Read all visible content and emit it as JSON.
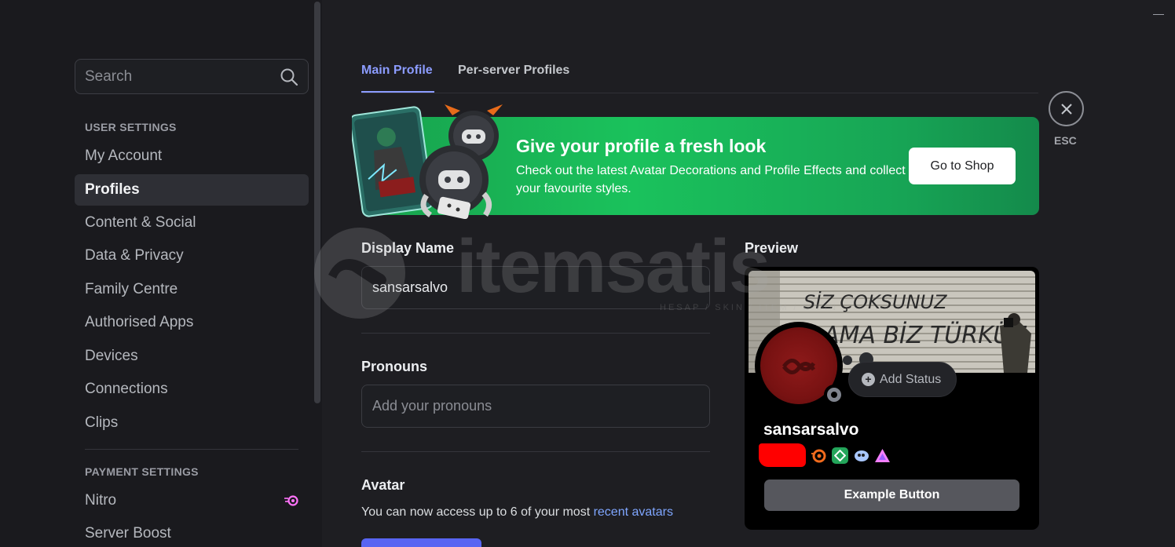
{
  "sidebar": {
    "search_placeholder": "Search",
    "user_settings_header": "USER SETTINGS",
    "items": [
      {
        "label": "My Account",
        "active": false
      },
      {
        "label": "Profiles",
        "active": true
      },
      {
        "label": "Content & Social",
        "active": false
      },
      {
        "label": "Data & Privacy",
        "active": false
      },
      {
        "label": "Family Centre",
        "active": false
      },
      {
        "label": "Authorised Apps",
        "active": false
      },
      {
        "label": "Devices",
        "active": false
      },
      {
        "label": "Connections",
        "active": false
      },
      {
        "label": "Clips",
        "active": false
      }
    ],
    "payment_settings_header": "PAYMENT SETTINGS",
    "payment_items": [
      {
        "label": "Nitro"
      },
      {
        "label": "Server Boost"
      }
    ]
  },
  "tabs": {
    "main": "Main Profile",
    "server": "Per-server Profiles"
  },
  "close": {
    "label": "ESC"
  },
  "banner": {
    "title": "Give your profile a fresh look",
    "description": "Check out the latest Avatar Decorations and Profile Effects and collect your favourite styles.",
    "button": "Go to Shop"
  },
  "form": {
    "display_name_label": "Display Name",
    "display_name_value": "sansarsalvo",
    "pronouns_label": "Pronouns",
    "pronouns_placeholder": "Add your pronouns",
    "avatar_label": "Avatar",
    "avatar_desc": "You can now access up to 6 of your most ",
    "avatar_link": "recent avatars"
  },
  "preview": {
    "label": "Preview",
    "username": "sansarsalvo",
    "add_status": "Add Status",
    "example_button": "Example Button",
    "banner_text_line1": "SİZ ÇOKSUNUZ",
    "banner_text_line2": "AMA BİZ TÜRKÜZ"
  },
  "watermark": {
    "text": "itemsatis",
    "subtext": "HESAP / SKIN / ITEM / E-PIN"
  },
  "colors": {
    "accent": "#8c9cff",
    "banner_green": "#1ac25c",
    "link": "#7fa6ff",
    "nitro": "#ff73fa"
  }
}
